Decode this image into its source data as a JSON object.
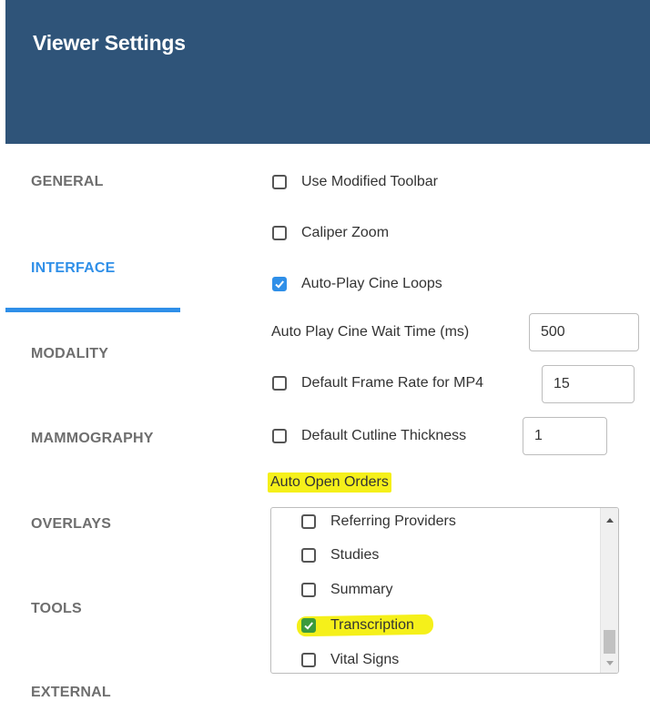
{
  "header": {
    "title": "Viewer Settings"
  },
  "sidebar": {
    "items": [
      {
        "label": "GENERAL"
      },
      {
        "label": "INTERFACE",
        "active": true
      },
      {
        "label": "MODALITY"
      },
      {
        "label": "MAMMOGRAPHY"
      },
      {
        "label": "OVERLAYS"
      },
      {
        "label": "TOOLS"
      },
      {
        "label": "EXTERNAL"
      }
    ]
  },
  "options": {
    "use_modified_toolbar": {
      "label": "Use Modified Toolbar",
      "checked": false
    },
    "caliper_zoom": {
      "label": "Caliper Zoom",
      "checked": false
    },
    "auto_play_cine_loops": {
      "label": "Auto-Play Cine Loops",
      "checked": true
    },
    "auto_play_wait": {
      "label": "Auto Play Cine Wait Time (ms)",
      "value": "500"
    },
    "default_frame_rate": {
      "label": "Default Frame Rate for MP4",
      "checked": false,
      "value": "15"
    },
    "default_cutline": {
      "label": "Default Cutline Thickness",
      "checked": false,
      "value": "1"
    }
  },
  "auto_open_orders": {
    "label": "Auto Open Orders",
    "items": [
      {
        "label": "Referring Providers",
        "checked": false
      },
      {
        "label": "Studies",
        "checked": false
      },
      {
        "label": "Summary",
        "checked": false
      },
      {
        "label": "Transcription",
        "checked": true
      },
      {
        "label": "Vital Signs",
        "checked": false
      }
    ]
  },
  "colors": {
    "header_bg": "#2f5479",
    "accent": "#2f8fe8",
    "highlight": "#f5f01a"
  }
}
